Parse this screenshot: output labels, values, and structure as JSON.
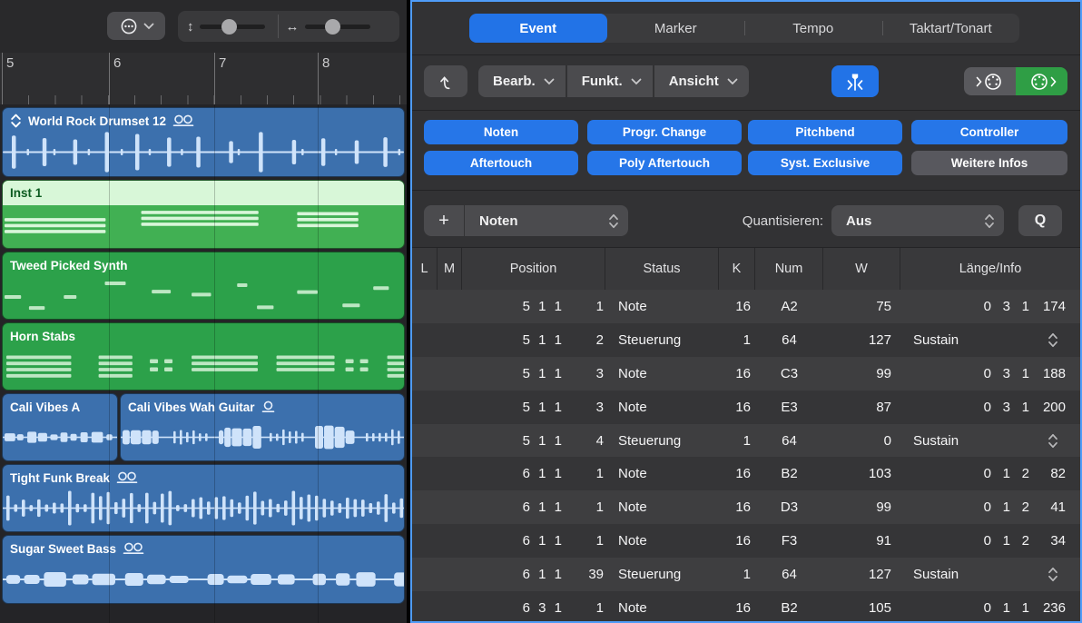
{
  "left": {
    "toolbar": {
      "options_icon": "options-ellipsis-icon",
      "vertical_zoom_icon": "up-down-arrow",
      "horizontal_zoom_icon": "left-right-arrow"
    },
    "ruler_bars": [
      "5",
      "6",
      "7",
      "8"
    ],
    "tracks": [
      {
        "name": "World Rock Drumset 12",
        "color": "blue",
        "selected": false,
        "prefix_icon": "transpose-icon",
        "loop_badge": 2,
        "pattern": "drum-spikes"
      },
      {
        "name": "Inst 1",
        "color": "green",
        "selected": true,
        "prefix_icon": null,
        "loop_badge": 0,
        "pattern": "note-chords"
      },
      {
        "name": "Tweed Picked Synth",
        "color": "green",
        "selected": false,
        "prefix_icon": null,
        "loop_badge": 0,
        "pattern": "note-melody"
      },
      {
        "name": "Horn Stabs",
        "color": "green",
        "selected": false,
        "prefix_icon": null,
        "loop_badge": 0,
        "pattern": "note-stabs"
      },
      {
        "name": "Cali Vibes A",
        "color": "blue",
        "selected": false,
        "prefix_icon": null,
        "loop_badge": 0,
        "pattern": "guitar-chop"
      },
      {
        "name": "Cali Vibes Wah Guitar",
        "color": "blue",
        "selected": false,
        "prefix_icon": null,
        "loop_badge": 1,
        "pattern": "wah-wave"
      },
      {
        "name": "Tight Funk Break",
        "color": "blue",
        "selected": false,
        "prefix_icon": null,
        "loop_badge": 2,
        "pattern": "funk-spikes"
      },
      {
        "name": "Sugar Sweet Bass",
        "color": "blue",
        "selected": false,
        "prefix_icon": null,
        "loop_badge": 2,
        "pattern": "bass-blobs"
      }
    ]
  },
  "panel": {
    "tabs": [
      {
        "label": "Event",
        "selected": true
      },
      {
        "label": "Marker",
        "selected": false
      },
      {
        "label": "Tempo",
        "selected": false
      },
      {
        "label": "Taktart/Tonart",
        "selected": false
      }
    ],
    "menus": [
      "Bearb.",
      "Funkt.",
      "Ansicht"
    ],
    "icons": {
      "up_level": "up-level-icon",
      "catch_playhead": "catch-playhead-icon",
      "midi_in": "midi-in-icon",
      "midi_out": "midi-out-icon"
    },
    "filters": [
      {
        "label": "Noten",
        "active": true
      },
      {
        "label": "Progr. Change",
        "active": true
      },
      {
        "label": "Pitchbend",
        "active": true
      },
      {
        "label": "Controller",
        "active": true
      },
      {
        "label": "Aftertouch",
        "active": true
      },
      {
        "label": "Poly Aftertouch",
        "active": true
      },
      {
        "label": "Syst. Exclusive",
        "active": true
      },
      {
        "label": "Weitere Infos",
        "active": false
      }
    ],
    "quantize": {
      "add_label": "+",
      "event_type_value": "Noten",
      "quantize_label": "Quantisieren:",
      "quantize_value": "Aus",
      "q_button": "Q"
    },
    "table": {
      "headers": [
        "L",
        "M",
        "Position",
        "Status",
        "K",
        "Num",
        "W",
        "Länge/Info"
      ],
      "rows": [
        {
          "pos": "5 1 1",
          "sub": "1",
          "status": "Note",
          "k": "16",
          "num": "A2",
          "w": "75",
          "info": "0 3 1 174",
          "stepper": false
        },
        {
          "pos": "5 1 1",
          "sub": "2",
          "status": "Steuerung",
          "k": "1",
          "num": "64",
          "w": "127",
          "info": "Sustain",
          "stepper": true
        },
        {
          "pos": "5 1 1",
          "sub": "3",
          "status": "Note",
          "k": "16",
          "num": "C3",
          "w": "99",
          "info": "0 3 1 188",
          "stepper": false
        },
        {
          "pos": "5 1 1",
          "sub": "3",
          "status": "Note",
          "k": "16",
          "num": "E3",
          "w": "87",
          "info": "0 3 1 200",
          "stepper": false
        },
        {
          "pos": "5 1 1",
          "sub": "4",
          "status": "Steuerung",
          "k": "1",
          "num": "64",
          "w": "0",
          "info": "Sustain",
          "stepper": true
        },
        {
          "pos": "6 1 1",
          "sub": "1",
          "status": "Note",
          "k": "16",
          "num": "B2",
          "w": "103",
          "info": "0 1 2 82",
          "stepper": false
        },
        {
          "pos": "6 1 1",
          "sub": "1",
          "status": "Note",
          "k": "16",
          "num": "D3",
          "w": "99",
          "info": "0 1 2 41",
          "stepper": false
        },
        {
          "pos": "6 1 1",
          "sub": "1",
          "status": "Note",
          "k": "16",
          "num": "F3",
          "w": "91",
          "info": "0 1 2 34",
          "stepper": false
        },
        {
          "pos": "6 1 1",
          "sub": "39",
          "status": "Steuerung",
          "k": "1",
          "num": "64",
          "w": "127",
          "info": "Sustain",
          "stepper": true
        },
        {
          "pos": "6 3 1",
          "sub": "1",
          "status": "Note",
          "k": "16",
          "num": "B2",
          "w": "105",
          "info": "0 1 1 236",
          "stepper": false
        }
      ]
    }
  },
  "colors": {
    "accent_blue": "#2273e7",
    "focus_border": "#4f9cf8",
    "region_blue": "#3c70ad",
    "region_green": "#2ca14a",
    "selected_region_header": "#d8f7d8",
    "midi_out_green": "#2f9e45",
    "waveform_blue": "#cfe3fa",
    "midi_note_green": "#bde7c3"
  }
}
